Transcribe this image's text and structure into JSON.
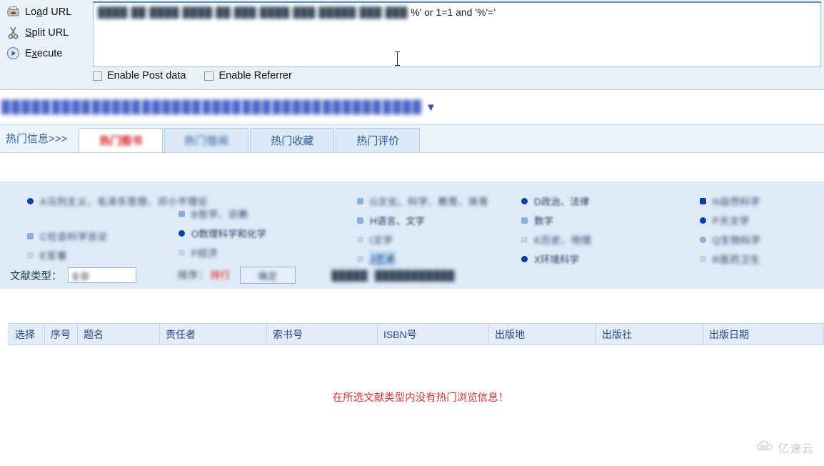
{
  "hackbar": {
    "actions": [
      {
        "icon": "load-url-icon",
        "label": "Load URL",
        "accesskey": "a"
      },
      {
        "icon": "split-url-icon",
        "label": "Split URL",
        "accesskey": "p"
      },
      {
        "icon": "execute-icon",
        "label": "Execute",
        "accesskey": "x"
      }
    ],
    "url_blurred": "████ ██ ████ ████ ██ ███ ████ ███ █████ ███ ███",
    "url_visible": "%' or 1=1 and '%'='",
    "checkboxes": [
      {
        "label": "Enable Post data",
        "checked": false
      },
      {
        "label": "Enable Referrer",
        "checked": false
      }
    ]
  },
  "sitenav": {
    "blurred_items": [
      "█████",
      "████",
      "█████",
      "██████",
      "████",
      "███",
      "█████",
      "██████",
      "████"
    ],
    "caret": "▼"
  },
  "tabs": {
    "lead_label": "热门信息>>>",
    "items": [
      {
        "label": "热门图书",
        "active": true,
        "blurred": true
      },
      {
        "label": "热门借阅",
        "active": false,
        "blurred": true
      },
      {
        "label": "热门收藏",
        "active": false,
        "blurred": false
      },
      {
        "label": "热门评价",
        "active": false,
        "blurred": false
      }
    ]
  },
  "categories": {
    "columns": [
      {
        "items": [
          {
            "label": "A马列主义、毛泽东思想、邓小平理论",
            "blur": "full",
            "bullet": "b0"
          },
          {
            "label": "C社会科学总论",
            "blur": "full",
            "bullet": "b1"
          },
          {
            "label": "E军事",
            "blur": "full",
            "bullet": "b2"
          }
        ]
      },
      {
        "items": [
          {
            "label": "B哲学、宗教",
            "blur": "full",
            "bullet": "b1"
          },
          {
            "label": "D政治、法律",
            "blur": "semi",
            "bullet": "b1"
          },
          {
            "label": "O数理科学和化学",
            "blur": "semi",
            "bullet": "b0"
          },
          {
            "label": "F经济",
            "blur": "full",
            "bullet": "b2"
          }
        ]
      },
      {
        "items": [
          {
            "label": "G文化、科学、教育、体育",
            "blur": "full",
            "bullet": "b1"
          },
          {
            "label": "H语言、文字",
            "blur": "semi",
            "bullet": "b1"
          },
          {
            "label": "I文学",
            "blur": "full",
            "bullet": "b2"
          },
          {
            "label": "J艺术",
            "blur": "full",
            "bullet": "b2"
          }
        ]
      },
      {
        "items": [
          {
            "label": "D政治、法律",
            "blur": "semi",
            "bullet": "b0"
          },
          {
            "label": "数字",
            "blur": "semi",
            "bullet": "b1"
          },
          {
            "label": "K历史、地理",
            "blur": "full",
            "bullet": "b2"
          },
          {
            "label": "X环境科学",
            "blur": "semi",
            "bullet": "b0"
          }
        ]
      },
      {
        "items": [
          {
            "label": "N自然科学",
            "blur": "full",
            "bullet": "b0"
          },
          {
            "label": "P天文学",
            "blur": "full",
            "bullet": "b1"
          },
          {
            "label": "Q生物科学",
            "blur": "full",
            "bullet": "b2"
          },
          {
            "label": "R医药卫生",
            "blur": "full",
            "bullet": "b2"
          }
        ]
      }
    ],
    "doc_type_label": "文献类型：",
    "doc_type_value": "全部",
    "sort_prefix": "排序：",
    "sort_highlight": "排行",
    "go_button": "确定",
    "extra_blurred": [
      "█████",
      "███████████"
    ]
  },
  "table": {
    "headers": [
      "选择",
      "序号",
      "题名",
      "责任者",
      "索书号",
      "ISBN号",
      "出版地",
      "出版社",
      "出版日期"
    ],
    "rows": [],
    "empty_message": "在所选文献类型内没有热门浏览信息！",
    "empty_color": "#e8342b"
  },
  "watermark": {
    "text": "亿速云",
    "icon": "cloud-icon"
  }
}
